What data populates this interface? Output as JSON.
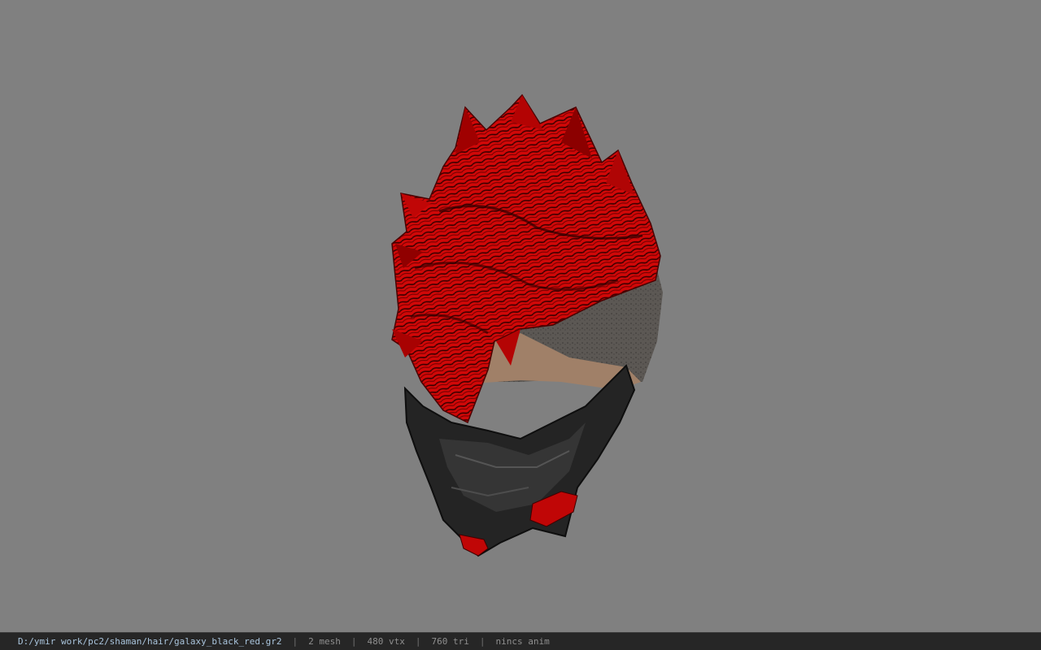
{
  "viewer": {
    "background_color": "#808080",
    "model_icon": "hair-mesh-model"
  },
  "status": {
    "file_path": "D:/ymir work/pc2/shaman/hair/galaxy_black_red.gr2",
    "separator": "|",
    "mesh": "2 mesh",
    "vertices": "480 vtx",
    "triangles": "760 tri",
    "animation": "nincs anim"
  }
}
